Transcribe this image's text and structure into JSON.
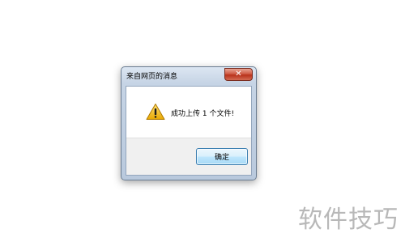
{
  "dialog": {
    "title": "来自网页的消息",
    "close_icon": "close-icon",
    "message": "成功上传 1 个文件!",
    "icon": "warning-icon",
    "ok_label": "确定"
  },
  "watermark": {
    "text": "软件技巧"
  }
}
